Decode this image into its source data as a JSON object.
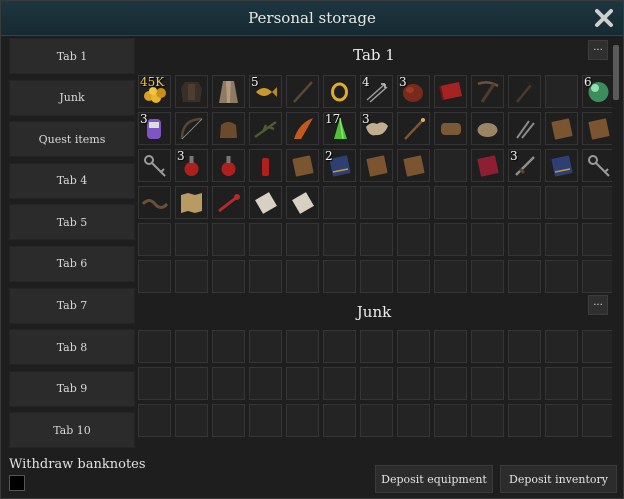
{
  "window": {
    "title": "Personal storage"
  },
  "sidebar": {
    "items": [
      {
        "label": "Tab 1"
      },
      {
        "label": "Junk"
      },
      {
        "label": "Quest items"
      },
      {
        "label": "Tab 4"
      },
      {
        "label": "Tab 5"
      },
      {
        "label": "Tab 6"
      },
      {
        "label": "Tab 7"
      },
      {
        "label": "Tab 8"
      },
      {
        "label": "Tab 9"
      },
      {
        "label": "Tab 10"
      }
    ]
  },
  "sections": [
    {
      "title": "Tab 1",
      "more_label": "...",
      "slots": [
        {
          "icon": "gold-coins-icon",
          "qty": "45K",
          "qty_gold": true
        },
        {
          "icon": "leather-armor-icon",
          "qty": ""
        },
        {
          "icon": "robe-icon",
          "qty": ""
        },
        {
          "icon": "fish-icon",
          "qty": "5"
        },
        {
          "icon": "staff-icon",
          "qty": ""
        },
        {
          "icon": "gold-ring-icon",
          "qty": ""
        },
        {
          "icon": "arrows-icon",
          "qty": "4"
        },
        {
          "icon": "meat-icon",
          "qty": "3"
        },
        {
          "icon": "red-scroll-icon",
          "qty": ""
        },
        {
          "icon": "crossbow-icon",
          "qty": ""
        },
        {
          "icon": "pickaxe-icon",
          "qty": ""
        },
        {
          "icon": "",
          "qty": ""
        },
        {
          "icon": "green-orb-icon",
          "qty": "6"
        },
        {
          "icon": "purple-potion-icon",
          "qty": "3"
        },
        {
          "icon": "bow-icon",
          "qty": ""
        },
        {
          "icon": "leather-bag-icon",
          "qty": ""
        },
        {
          "icon": "branch-icon",
          "qty": ""
        },
        {
          "icon": "horn-icon",
          "qty": ""
        },
        {
          "icon": "green-crystal-icon",
          "qty": "17"
        },
        {
          "icon": "hide-icon",
          "qty": "3"
        },
        {
          "icon": "wand-icon",
          "qty": ""
        },
        {
          "icon": "brown-item-icon",
          "qty": ""
        },
        {
          "icon": "pouch-icon",
          "qty": ""
        },
        {
          "icon": "daggers-icon",
          "qty": ""
        },
        {
          "icon": "book-icon",
          "qty": ""
        },
        {
          "icon": "book-icon",
          "qty": ""
        },
        {
          "icon": "key-icon",
          "qty": ""
        },
        {
          "icon": "red-potion-icon",
          "qty": "3"
        },
        {
          "icon": "red-potion-icon",
          "qty": ""
        },
        {
          "icon": "red-vial-icon",
          "qty": ""
        },
        {
          "icon": "book-icon",
          "qty": ""
        },
        {
          "icon": "blue-book-icon",
          "qty": "2"
        },
        {
          "icon": "book-icon",
          "qty": ""
        },
        {
          "icon": "book-icon",
          "qty": ""
        },
        {
          "icon": "",
          "qty": ""
        },
        {
          "icon": "red-book-icon",
          "qty": ""
        },
        {
          "icon": "dagger-icon",
          "qty": "3"
        },
        {
          "icon": "blue-book-icon",
          "qty": ""
        },
        {
          "icon": "key-icon",
          "qty": ""
        },
        {
          "icon": "rope-icon",
          "qty": ""
        },
        {
          "icon": "map-icon",
          "qty": ""
        },
        {
          "icon": "red-key-icon",
          "qty": ""
        },
        {
          "icon": "scroll-icon",
          "qty": ""
        },
        {
          "icon": "scroll-icon",
          "qty": ""
        }
      ]
    },
    {
      "title": "Junk",
      "more_label": "..."
    }
  ],
  "footer": {
    "withdraw_banknotes_label": "Withdraw banknotes",
    "deposit_equipment_label": "Deposit equipment",
    "deposit_inventory_label": "Deposit inventory"
  }
}
